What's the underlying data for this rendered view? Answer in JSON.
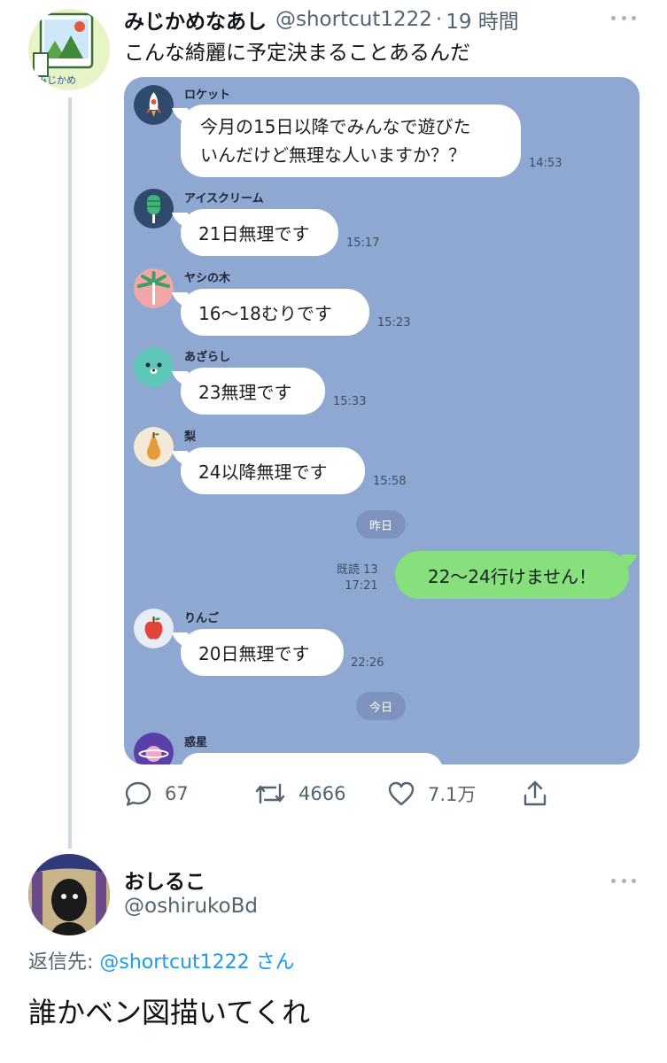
{
  "tweet": {
    "author_name": "みじかめなあし",
    "author_handle": "@shortcut1222",
    "separator": "·",
    "time": "19 時間",
    "text": "こんな綺麗に予定決まることあるんだ",
    "avatar_text": "みじかめ",
    "chat": {
      "messages": [
        {
          "sender": "ロケット",
          "icon": "rocket-icon",
          "lines": [
            "今月の15日以降でみんなで遊びた",
            "いんだけど無理な人いますか？？"
          ],
          "time": "14:53"
        },
        {
          "sender": "アイスクリーム",
          "icon": "ice-cream-icon",
          "text": "21日無理です",
          "time": "15:17"
        },
        {
          "sender": "ヤシの木",
          "icon": "palm-tree-icon",
          "text": "16～18むりです",
          "time": "15:23"
        },
        {
          "sender": "あざらし",
          "icon": "seal-icon",
          "text": "23無理です",
          "time": "15:33"
        },
        {
          "sender": "梨",
          "icon": "pear-icon",
          "text": "24以降無理です",
          "time": "15:58"
        },
        {
          "sender": "りんご",
          "icon": "apple-icon",
          "text": "20日無理です",
          "time": "22:26"
        },
        {
          "sender": "惑星",
          "icon": "planet-icon"
        }
      ],
      "date_yesterday": "昨日",
      "date_today": "今日",
      "own_message": {
        "text": "22～24行けません！",
        "read_receipt": "既読 13",
        "time": "17:21"
      }
    },
    "actions": {
      "replies": "67",
      "retweets": "4666",
      "likes": "7.1万"
    }
  },
  "reply": {
    "author_name": "おしるこ",
    "author_handle": "@oshirukoBd",
    "replying_to_prefix": "返信先: ",
    "replying_to_handle": "@shortcut1222",
    "replying_to_suffix": " さん",
    "text": "誰かベン図描いてくれ"
  },
  "colors": {
    "chat_background": "#8fa8d1",
    "own_bubble": "#86e07b",
    "link": "#1d9bf0",
    "secondary_text": "#536471"
  }
}
